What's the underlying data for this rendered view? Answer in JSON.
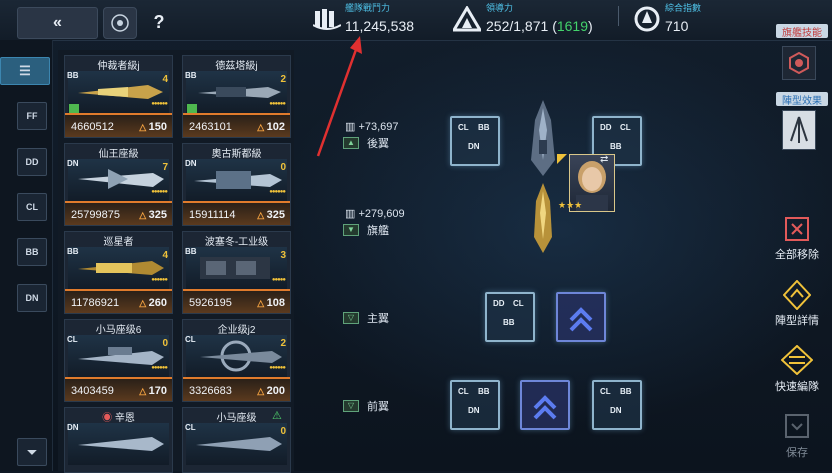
{
  "topbar": {
    "back_icon": "double-chevron-left",
    "settings_icon": "target-circle",
    "help_label": "?",
    "fleet_power": {
      "label": "艦隊戰鬥力",
      "value": "11,245,538"
    },
    "command": {
      "label": "領導力",
      "value": "252/1,871",
      "extra": "1619",
      "open": "(",
      "close": ")"
    },
    "overall": {
      "label": "綜合指數",
      "value": "710"
    }
  },
  "rail": {
    "items": [
      {
        "label": "list"
      },
      {
        "label": "FF"
      },
      {
        "label": "DD"
      },
      {
        "label": "CL"
      },
      {
        "label": "BB"
      },
      {
        "label": "DN"
      }
    ],
    "filter_icon": "filter-icon"
  },
  "ships": [
    {
      "name": "仲裁者級j",
      "type": "BB",
      "count": "4",
      "power": "4660512",
      "level": "150"
    },
    {
      "name": "德茲塔級j",
      "type": "BB",
      "count": "2",
      "power": "2463101",
      "level": "102"
    },
    {
      "name": "仙王座級",
      "type": "DN",
      "count": "7",
      "power": "25799875",
      "level": "325"
    },
    {
      "name": "奧古斯都級",
      "type": "DN",
      "count": "0",
      "power": "15911114",
      "level": "325"
    },
    {
      "name": "巡星者",
      "type": "BB",
      "count": "4",
      "power": "11786921",
      "level": "260"
    },
    {
      "name": "波塞冬-工业级",
      "type": "BB",
      "count": "3",
      "power": "5926195",
      "level": "108"
    },
    {
      "name": "小马座级6",
      "type": "CL",
      "count": "0",
      "power": "3403459",
      "level": "170"
    },
    {
      "name": "企业级j2",
      "type": "CL",
      "count": "2",
      "power": "3326683",
      "level": "200"
    },
    {
      "name": "辛恩",
      "type": "DN",
      "count": "",
      "power": "",
      "level": ""
    },
    {
      "name": "小马座级",
      "type": "CL",
      "count": "0",
      "power": "",
      "level": ""
    }
  ],
  "formation": {
    "rear": {
      "power": "+73,697",
      "label": "後翼"
    },
    "flagship": {
      "power": "+279,609",
      "label": "旗艦"
    },
    "main": {
      "label": "主翼"
    },
    "front": {
      "label": "前翼"
    },
    "slot_labels": {
      "cl": "CL",
      "bb": "BB",
      "dn": "DN",
      "dd": "DD"
    },
    "stars": "★★★"
  },
  "right": {
    "flagship_skill": "旗艦技能",
    "formation_effect": "陣型效果",
    "remove_all": "全部移除",
    "formation_detail": "陣型詳情",
    "quick_edit": "快速編隊",
    "save": "保存"
  }
}
